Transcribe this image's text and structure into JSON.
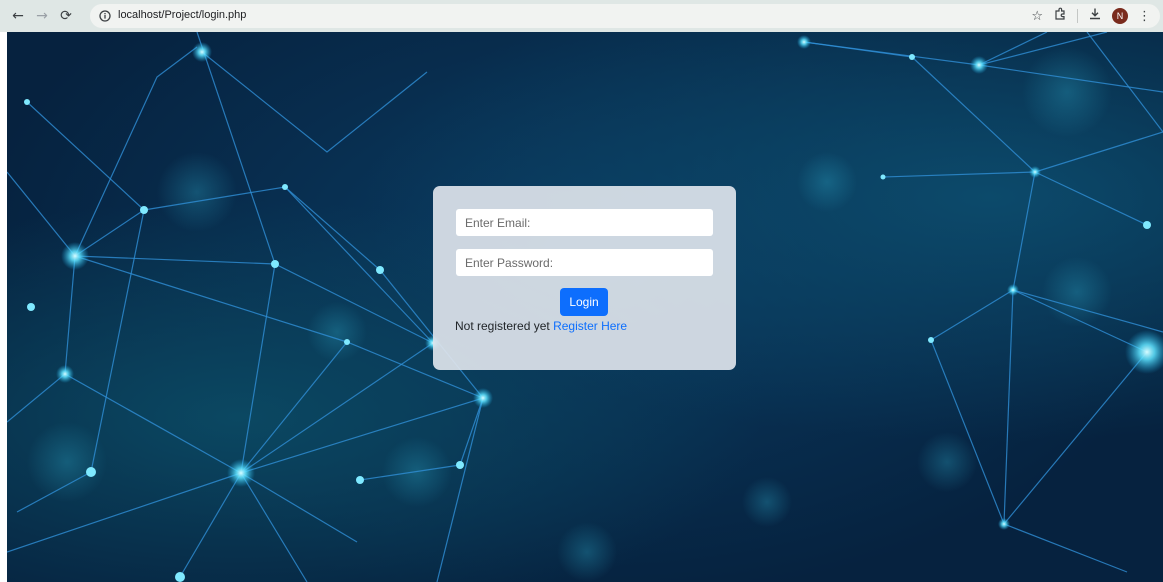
{
  "browser": {
    "url": "localhost/Project/login.php",
    "profile_initial": "N"
  },
  "login": {
    "email_placeholder": "Enter Email:",
    "password_placeholder": "Enter Password:",
    "login_button": "Login",
    "register_prompt": "Not registered yet",
    "register_link": "Register Here"
  },
  "colors": {
    "primary": "#0d6efd",
    "background": "#06223f",
    "network_line": "#2f8fd6",
    "network_node": "#5fe3ff"
  }
}
